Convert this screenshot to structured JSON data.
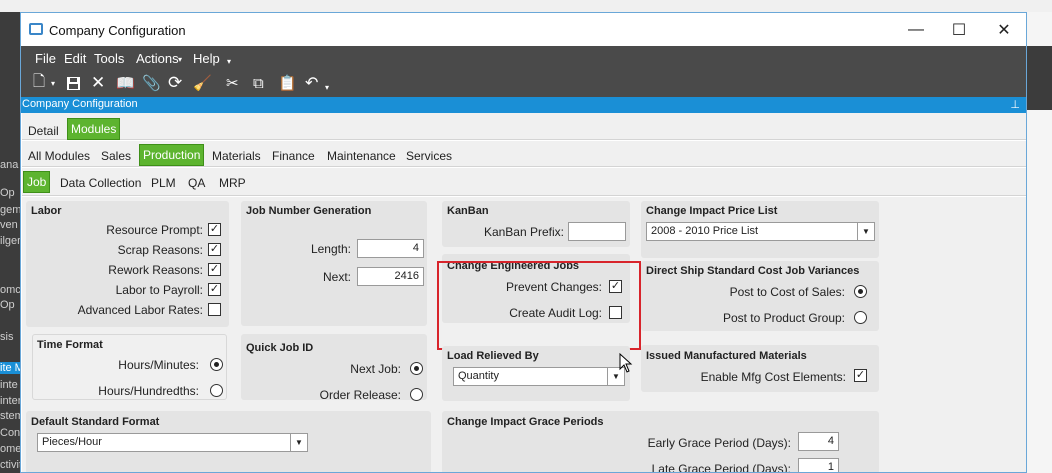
{
  "window": {
    "title": "Company Configuration"
  },
  "titlebar_buttons": [
    "—",
    "☐",
    "✕"
  ],
  "menu": [
    "File",
    "Edit",
    "Tools",
    "Actions",
    "Help"
  ],
  "menu_suffix": {
    "actions": "▾",
    "help": "▾"
  },
  "panel": {
    "title": "Company Configuration",
    "pin": "📌"
  },
  "tabs_top": [
    "Detail",
    "Modules"
  ],
  "tabs_modules": [
    "All Modules",
    "Sales",
    "Production",
    "Materials",
    "Finance",
    "Maintenance",
    "Services"
  ],
  "tabs_production": [
    "Job",
    "Data Collection",
    "PLM",
    "QA",
    "MRP"
  ],
  "labor": {
    "title": "Labor",
    "items": [
      {
        "label": "Resource Prompt:",
        "checked": "✓"
      },
      {
        "label": "Scrap Reasons:",
        "checked": "✓"
      },
      {
        "label": "Rework Reasons:",
        "checked": "✓"
      },
      {
        "label": "Labor to Payroll:",
        "checked": "✓"
      },
      {
        "label": "Advanced Labor Rates:",
        "checked": ""
      }
    ]
  },
  "time_format": {
    "title": "Time Format",
    "options": [
      "Hours/Minutes:",
      "Hours/Hundredths:"
    ]
  },
  "job_number": {
    "title": "Job Number Generation",
    "length_label": "Length:",
    "length_value": "4",
    "next_label": "Next:",
    "next_value": "2416"
  },
  "quick_job": {
    "title": "Quick Job ID",
    "options": [
      "Next Job:",
      "Order Release:"
    ]
  },
  "kanban": {
    "title": "KanBan",
    "prefix_label": "KanBan Prefix:",
    "prefix_value": ""
  },
  "change_engineered": {
    "title": "Change Engineered Jobs",
    "prevent_label": "Prevent Changes:",
    "prevent_checked": "✓",
    "audit_label": "Create Audit Log:",
    "audit_checked": ""
  },
  "load_relieved": {
    "title": "Load Relieved By",
    "value": "Quantity"
  },
  "price_list": {
    "title": "Change Impact Price List",
    "value": "2008 - 2010 Price List"
  },
  "direct_ship": {
    "title": "Direct Ship Standard Cost Job Variances",
    "options": [
      "Post to Cost of Sales:",
      "Post to Product Group:"
    ]
  },
  "issued_mfg": {
    "title": "Issued Manufactured Materials",
    "enable_label": "Enable Mfg Cost Elements:",
    "enable_checked": "✓"
  },
  "default_format": {
    "title": "Default Standard Format",
    "value": "Pieces/Hour"
  },
  "grace": {
    "title": "Change Impact Grace Periods",
    "early_label": "Early Grace Period (Days):",
    "early_value": "4",
    "late_label": "Late Grace Period (Days):",
    "late_value": "1"
  },
  "background_left": [
    "ana",
    "Op",
    "gem",
    "ven",
    "ilger",
    "omc",
    "Op",
    "sis",
    "ite M",
    "inte",
    "inter",
    "stem",
    "Con",
    "omer",
    "ctivit"
  ],
  "colors": {
    "accent": "#1a8fd6",
    "active_tab": "#5db42f",
    "highlight_border": "#d8242b",
    "toolbar": "#4a4a4a"
  }
}
